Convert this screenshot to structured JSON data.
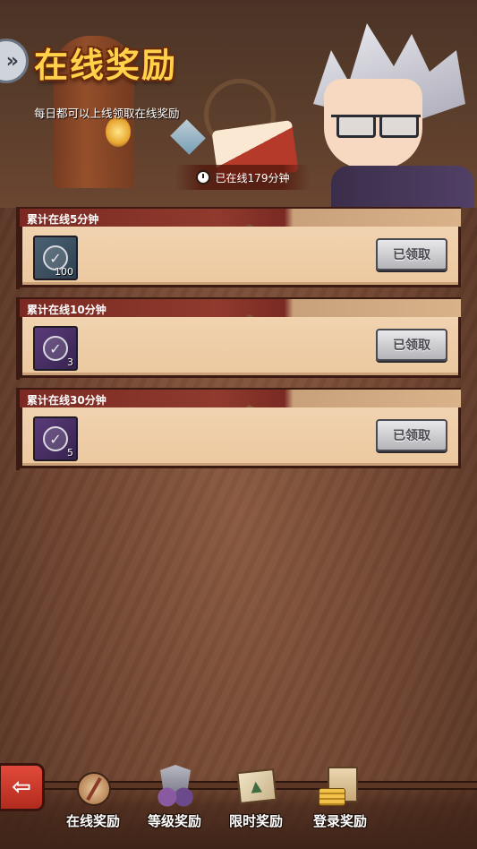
{
  "header": {
    "title": "在线奖励",
    "subtitle": "每日都可以上线领取在线奖励",
    "online_status": "已在线179分钟"
  },
  "rewards": [
    {
      "label": "累计在线5分钟",
      "item_count": "100",
      "item_color": "blue",
      "button_label": "已领取"
    },
    {
      "label": "累计在线10分钟",
      "item_count": "3",
      "item_color": "purple",
      "button_label": "已领取"
    },
    {
      "label": "累计在线30分钟",
      "item_count": "5",
      "item_color": "purple",
      "button_label": "已领取"
    }
  ],
  "bottom_nav": {
    "items": [
      {
        "label": "在线奖励",
        "icon": "compass-icon"
      },
      {
        "label": "等级奖励",
        "icon": "shield-gems-icon"
      },
      {
        "label": "限时奖励",
        "icon": "map-icon"
      },
      {
        "label": "登录奖励",
        "icon": "scroll-coins-icon"
      }
    ]
  },
  "colors": {
    "title_gold": "#ffd24a",
    "header_red": "#7a2a23",
    "card_parchment": "#f1d3b0",
    "claimed_button_gray": "#b5b5b9",
    "back_button_red": "#e24a3a"
  }
}
